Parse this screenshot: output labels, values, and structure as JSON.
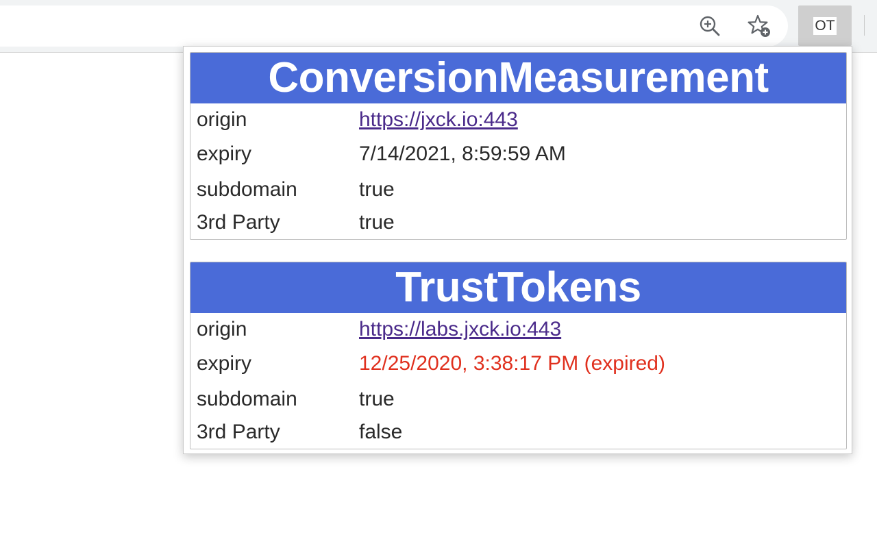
{
  "browser": {
    "zoom_icon": "zoom-in-icon",
    "bookmark_icon": "star-add-icon",
    "extension_badge": "OT"
  },
  "trials": [
    {
      "name": "ConversionMeasurement",
      "rows": {
        "origin": {
          "label": "origin",
          "value": "https://jxck.io:443"
        },
        "expiry": {
          "label": "expiry",
          "value": "7/14/2021, 8:59:59 AM"
        },
        "subdomain": {
          "label": "subdomain",
          "value": "true"
        },
        "third_party": {
          "label": "3rd Party",
          "value": "true"
        }
      }
    },
    {
      "name": "TrustTokens",
      "rows": {
        "origin": {
          "label": "origin",
          "value": "https://labs.jxck.io:443"
        },
        "expiry": {
          "label": "expiry",
          "value": "12/25/2020, 3:38:17 PM (expired)"
        },
        "subdomain": {
          "label": "subdomain",
          "value": "true"
        },
        "third_party": {
          "label": "3rd Party",
          "value": "false"
        }
      }
    }
  ],
  "colors": {
    "header_bg": "#4a6bd8",
    "link": "#4a2a8a",
    "expired": "#e0301e"
  }
}
